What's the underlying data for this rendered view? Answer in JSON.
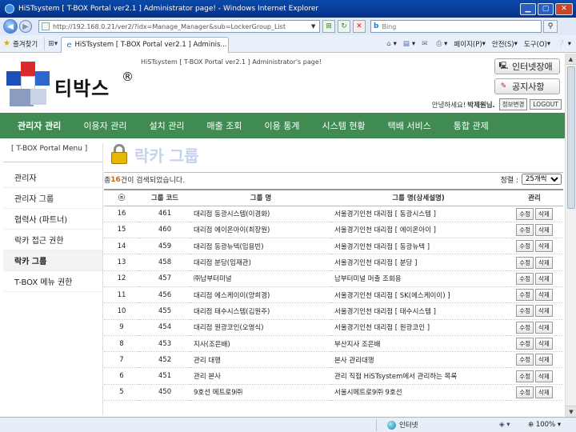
{
  "browser": {
    "window_title": "HiSTsystem [ T-BOX Portal ver2.1 ] Administrator page! - Windows Internet Explorer",
    "url": "http://192.168.0.21/ver2/?idx=Manage_Manager&sub=LockerGroup_List",
    "search_placeholder": "Bing",
    "favorites_label": "즐겨찾기",
    "tab_title": "HiSTsystem [ T-BOX Portal ver2.1 ] Adminis...",
    "commands": {
      "page": "페이지(P)",
      "safety": "안전(S)",
      "tools": "도구(O)"
    },
    "status_zone": "인터넷",
    "zoom": "100%"
  },
  "header": {
    "site_title": "HiSTsystem [ T-BOX Portal ver2.1 ] Administrator's page!",
    "brand": "티박스",
    "brand_mark": "®",
    "internet_order_button": "인터넷장애",
    "notice_button": "공지사항",
    "greeting_prefix": "안녕하세요!",
    "user_name": "박제원님.",
    "change_info_button": "정보변경",
    "logout_button": "LOGOUT"
  },
  "main_nav": [
    "관리자 관리",
    "이용자 관리",
    "설치 관리",
    "매출 조회",
    "이용 통계",
    "시스템 현황",
    "택배 서비스",
    "통합 관제"
  ],
  "left_menu": {
    "title": "[ T-BOX Portal Menu ]",
    "items": [
      "관리자",
      "관리자 그룹",
      "협력사 (파트너)",
      "락카 접근 권한",
      "락카 그룹",
      "T-BOX 메뉴 권한"
    ]
  },
  "content": {
    "page_title": "락카 그룹",
    "count_prefix": "총",
    "count_value": "16",
    "count_suffix": "건이 검색되었습니다.",
    "sort_label": "정렬 :",
    "sort_selected": "25개씩",
    "columns": {
      "no": "ⓝ",
      "code": "그룹 코드",
      "name": "그룹 명",
      "detail": "그룹 명(상세설명)",
      "manage": "관리"
    },
    "edit_label": "수정",
    "delete_label": "삭제",
    "rows": [
      {
        "no": "16",
        "code": "461",
        "name": "대리점 동광시스템(이경화)",
        "detail": "서울경기인천 대리점 [ 동광시스템 ]"
      },
      {
        "no": "15",
        "code": "460",
        "name": "대리점 에이온아이(최장원)",
        "detail": "서울경기인천 대리점 [ 에이온아이 ]"
      },
      {
        "no": "14",
        "code": "459",
        "name": "대리점 동광뉴텍(임용빈)",
        "detail": "서울경기인천 대리점 [ 동광뉴텍 ]"
      },
      {
        "no": "13",
        "code": "458",
        "name": "대리점 분당(임재관)",
        "detail": "서울경기인천 대리점 [ 분당 ]"
      },
      {
        "no": "12",
        "code": "457",
        "name": "㈜남부터미널",
        "detail": "남부터미널 머출 조회용"
      },
      {
        "no": "11",
        "code": "456",
        "name": "대리점 에스케이이(양희경)",
        "detail": "서울경기인천 대리점 [ SK(에스케이이) ]"
      },
      {
        "no": "10",
        "code": "455",
        "name": "대리점 태수시스템(김원주)",
        "detail": "서울경기인천 대리점 [ 태수시스템 ]"
      },
      {
        "no": "9",
        "code": "454",
        "name": "대리점 원광코인(오영식)",
        "detail": "서울경기인천 대리점 [ 원광코인 ]"
      },
      {
        "no": "8",
        "code": "453",
        "name": "지사(조은배)",
        "detail": "부산지사 조은배"
      },
      {
        "no": "7",
        "code": "452",
        "name": "관리 대행",
        "detail": "본사 관리대행"
      },
      {
        "no": "6",
        "code": "451",
        "name": "관리 본사",
        "detail": "관리 직접 HiSTsystem에서 관리하는 목록"
      },
      {
        "no": "5",
        "code": "450",
        "name": "9호선 메트로9㈜",
        "detail": "서울시메트로9㈜ 9호선"
      }
    ]
  },
  "colors": {
    "nav_green": "#3f8b52",
    "count_orange": "#cc6600",
    "title_faded_blue": "#c4d2ec"
  }
}
